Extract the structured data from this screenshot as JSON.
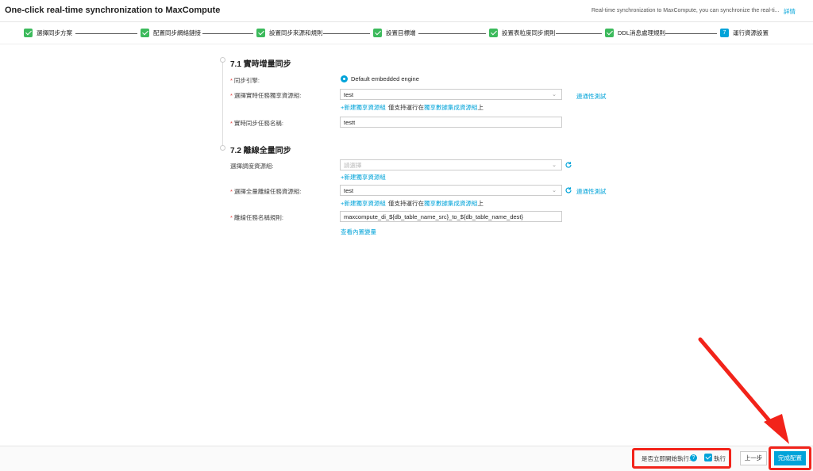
{
  "header": {
    "title": "One-click real-time synchronization to MaxCompute",
    "notice": "Real-time synchronization to MaxCompute, you can synchronize the real-ti...",
    "detail_link": "詳情"
  },
  "steps": [
    {
      "label": "選擇同步方案",
      "done": true
    },
    {
      "label": "配置同步網絡鏈接",
      "done": true
    },
    {
      "label": "設置同步來源和規則",
      "done": true
    },
    {
      "label": "設置目標端",
      "done": true
    },
    {
      "label": "設置表粒度同步規則",
      "done": true
    },
    {
      "label": "DDL消息處理規則",
      "done": true
    },
    {
      "label": "運行資源設置",
      "done": false,
      "number": "7"
    }
  ],
  "section1": {
    "title": "7.1 實時增量同步",
    "engine_label": "同步引擎:",
    "engine_option": "Default embedded engine",
    "resource_group_label": "選擇實時任務獨享資源組:",
    "resource_group_value": "test",
    "connectivity_test": "連通性測試",
    "new_group_link": "+新建獨享資源組",
    "support_note_prefix": "僅支持運行在",
    "support_note_link": "獨享數據集成資源組",
    "support_note_suffix": "上",
    "task_name_label": "實時同步任務名稱:",
    "task_name_value": "testt"
  },
  "section2": {
    "title": "7.2 離線全量同步",
    "schedule_group_label": "選擇調度資源組:",
    "schedule_group_placeholder": "請選擇",
    "new_group_link": "+新建獨享資源組",
    "offline_group_label": "選擇全量離線任務資源組:",
    "offline_group_value": "test",
    "connectivity_test": "連通性測試",
    "new_group_link2": "+新建獨享資源組",
    "support_note_prefix": "僅支持運行在",
    "support_note_link": "獨享數據集成資源組",
    "support_note_suffix": "上",
    "name_rule_label": "離線任務名稱規則:",
    "name_rule_value": "maxcompute_di_${db_table_name_src}_to_${db_table_name_dest}",
    "view_vars_link": "查看內置變量"
  },
  "footer": {
    "run_now_label": "是否立即開始執行:",
    "run_checkbox_label": "執行",
    "run_checked": true,
    "prev_button": "上一步",
    "finish_button": "完成配置"
  },
  "colors": {
    "accent": "#00a3d9",
    "done": "#3cba5c",
    "annotation": "#f2231a"
  }
}
